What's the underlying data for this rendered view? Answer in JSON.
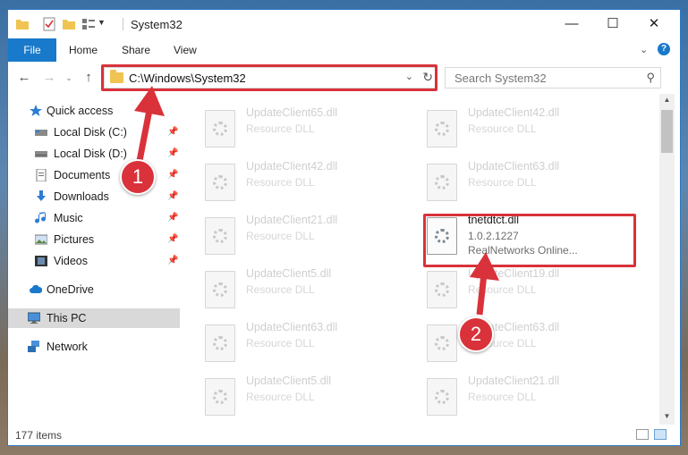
{
  "window": {
    "title": "System32"
  },
  "ribbon": {
    "tabs": [
      "File",
      "Home",
      "Share",
      "View"
    ]
  },
  "address": {
    "path": "C:\\Windows\\System32"
  },
  "search": {
    "placeholder": "Search System32"
  },
  "sidebar": {
    "items": [
      {
        "label": "Quick access",
        "icon": "star-icon",
        "pinned": false
      },
      {
        "label": "Local Disk (C:)",
        "icon": "drive-icon",
        "pinned": true
      },
      {
        "label": "Local Disk (D:)",
        "icon": "drive-icon",
        "pinned": true
      },
      {
        "label": "Documents",
        "icon": "documents-icon",
        "pinned": true
      },
      {
        "label": "Downloads",
        "icon": "downloads-icon",
        "pinned": true
      },
      {
        "label": "Music",
        "icon": "music-icon",
        "pinned": true
      },
      {
        "label": "Pictures",
        "icon": "pictures-icon",
        "pinned": true
      },
      {
        "label": "Videos",
        "icon": "videos-icon",
        "pinned": true
      },
      {
        "label": "OneDrive",
        "icon": "cloud-icon",
        "pinned": false
      },
      {
        "label": "This PC",
        "icon": "computer-icon",
        "pinned": false,
        "selected": true
      },
      {
        "label": "Network",
        "icon": "network-icon",
        "pinned": false
      }
    ]
  },
  "files": [
    {
      "name": "UpdateClient65.dll",
      "desc": "Resource DLL"
    },
    {
      "name": "UpdateClient42.dll",
      "desc": "Resource DLL"
    },
    {
      "name": "UpdateClient42.dll",
      "desc": "Resource DLL"
    },
    {
      "name": "UpdateClient63.dll",
      "desc": "Resource DLL"
    },
    {
      "name": "UpdateClient21.dll",
      "desc": "Resource DLL"
    },
    {
      "name": "tnetdtct.dll",
      "desc": "1.0.2.1227",
      "company": "RealNetworks Online...",
      "active": true
    },
    {
      "name": "UpdateClient5.dll",
      "desc": "Resource DLL"
    },
    {
      "name": "UpdateClient19.dll",
      "desc": "Resource DLL"
    },
    {
      "name": "UpdateClient63.dll",
      "desc": "Resource DLL"
    },
    {
      "name": "UpdateClient63.dll",
      "desc": "Resource DLL"
    },
    {
      "name": "UpdateClient5.dll",
      "desc": "Resource DLL"
    },
    {
      "name": "UpdateClient21.dll",
      "desc": "Resource DLL"
    }
  ],
  "status": {
    "item_count": "177 items"
  },
  "callouts": [
    "1",
    "2"
  ],
  "colors": {
    "accent": "#1979ca",
    "annotation": "#d9323a"
  }
}
